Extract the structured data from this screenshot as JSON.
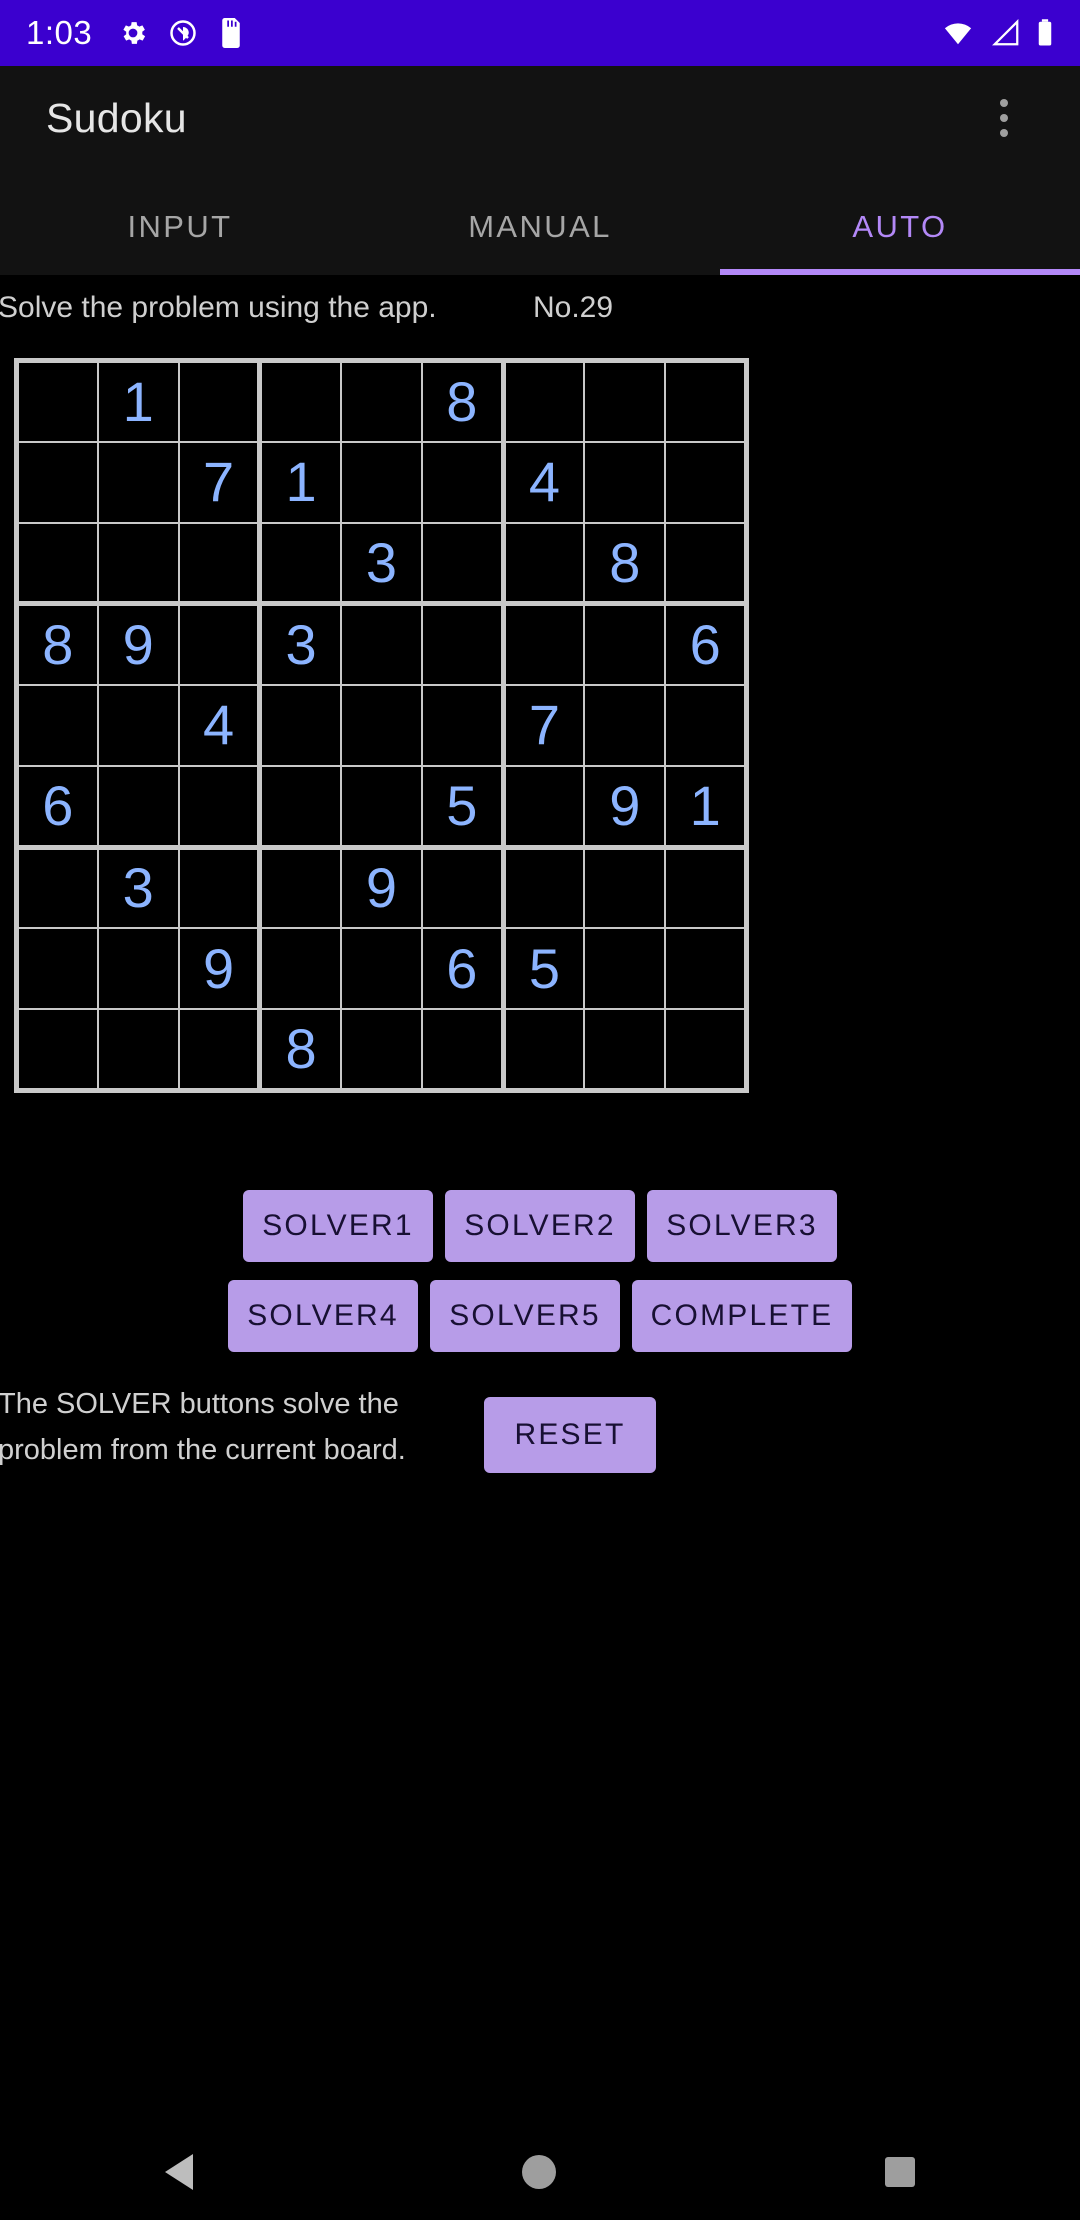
{
  "status_bar": {
    "time": "1:03",
    "left_icons": [
      "settings-gear-icon",
      "no-location-icon",
      "sd-card-icon"
    ],
    "right_icons": [
      "wifi-icon",
      "cellular-signal-icon",
      "battery-icon"
    ],
    "background_color": "#3b00cf"
  },
  "app_bar": {
    "title": "Sudoku",
    "overflow_menu_icon": "more-vert-icon"
  },
  "tabs": [
    {
      "label": "INPUT",
      "active": false
    },
    {
      "label": "MANUAL",
      "active": false
    },
    {
      "label": "AUTO",
      "active": true
    }
  ],
  "tab_accent_color": "#b388f7",
  "info": {
    "instruction": "Solve the problem using the app.",
    "problem_number": "No.29"
  },
  "board": {
    "digit_color": "#8cb4ff",
    "line_color": "#c9c9c9",
    "cells": [
      [
        "",
        "1",
        "",
        "",
        "",
        "8",
        "",
        "",
        ""
      ],
      [
        "",
        "",
        "7",
        "1",
        "",
        "",
        "4",
        "",
        ""
      ],
      [
        "",
        "",
        "",
        "",
        "3",
        "",
        "",
        "8",
        ""
      ],
      [
        "8",
        "9",
        "",
        "3",
        "",
        "",
        "",
        "",
        "6"
      ],
      [
        "",
        "",
        "4",
        "",
        "",
        "",
        "7",
        "",
        ""
      ],
      [
        "6",
        "",
        "",
        "",
        "",
        "5",
        "",
        "9",
        "1"
      ],
      [
        "",
        "3",
        "",
        "",
        "9",
        "",
        "",
        "",
        ""
      ],
      [
        "",
        "",
        "9",
        "",
        "",
        "6",
        "5",
        "",
        ""
      ],
      [
        "",
        "",
        "",
        "8",
        "",
        "",
        "",
        "",
        ""
      ]
    ]
  },
  "buttons": {
    "accent_color": "#b79ce8",
    "row1": [
      "SOLVER1",
      "SOLVER2",
      "SOLVER3"
    ],
    "row2": [
      "SOLVER4",
      "SOLVER5",
      "COMPLETE"
    ],
    "reset": "RESET"
  },
  "footer": {
    "note_line1": "The SOLVER buttons solve the",
    "note_line2": "problem from the current board."
  },
  "nav_bar": {
    "back_icon": "back-triangle-icon",
    "home_icon": "home-circle-icon",
    "recents_icon": "recents-square-icon"
  }
}
